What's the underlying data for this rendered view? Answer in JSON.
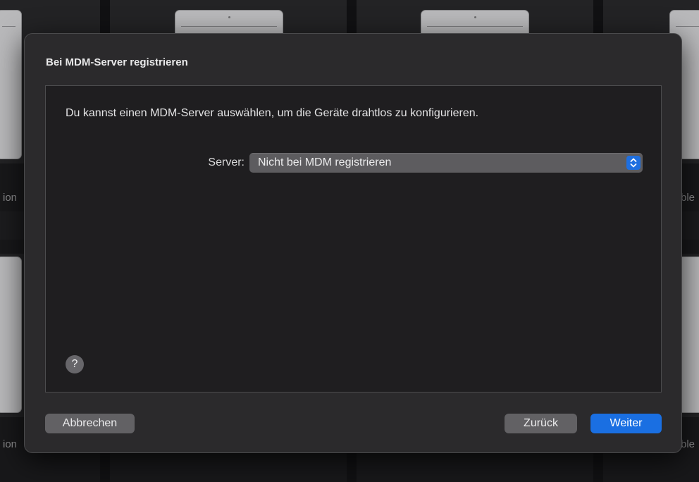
{
  "background": {
    "left_fragments": [
      "ion",
      "ion"
    ],
    "right_fragments": [
      "ble",
      "ble"
    ]
  },
  "sheet": {
    "title": "Bei MDM-Server registrieren",
    "description": "Du kannst einen MDM-Server auswählen, um die Geräte drahtlos zu konfigurieren.",
    "server": {
      "label": "Server:",
      "selected_value": "Nicht bei MDM registrieren",
      "arrows_icon": "popup-up-down-arrows-icon"
    },
    "help": {
      "glyph": "?",
      "icon": "help-icon"
    },
    "buttons": {
      "cancel": "Abbrechen",
      "back": "Zurück",
      "next": "Weiter"
    }
  },
  "colors": {
    "accent": "#1a6fe2",
    "sheet_bg": "#2b2a2c",
    "content_bg": "#1f1e20",
    "button_bg": "#626164"
  }
}
